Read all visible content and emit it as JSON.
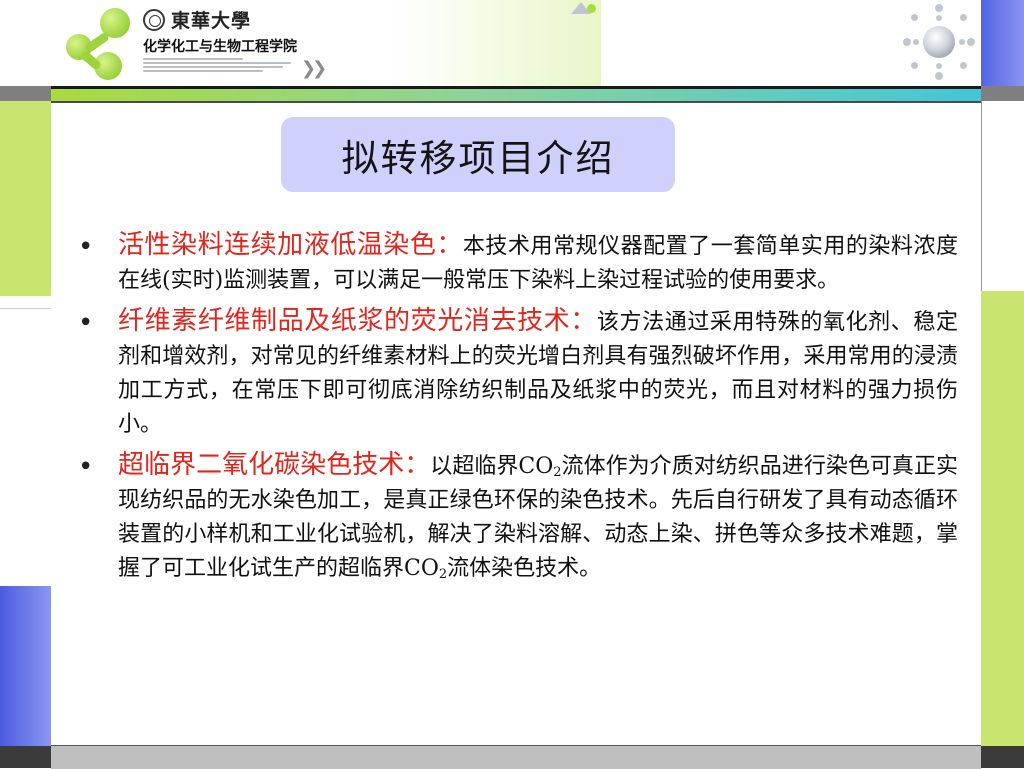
{
  "header": {
    "university_name": "東華大學",
    "school_name": "化学化工与生物工程学院"
  },
  "slide": {
    "title": "拟转移项目介绍",
    "bullets": [
      {
        "mark": "•",
        "lead": "活性染料连续加液低温染色：",
        "body": "本技术用常规仪器配置了一套简单实用的染料浓度在线(实时)监测装置，可以满足一般常压下染料上染过程试验的使用要求。"
      },
      {
        "mark": "•",
        "lead": "纤维素纤维制品及纸浆的荧光消去技术：",
        "body": "该方法通过采用特殊的氧化剂、稳定剂和增效剂，对常见的纤维素材料上的荧光增白剂具有强烈破坏作用，采用常用的浸渍加工方式，在常压下即可彻底消除纺织制品及纸浆中的荧光，而且对材料的强力损伤小。"
      },
      {
        "mark": "•",
        "lead": "超临界二氧化碳染色技术：",
        "body_a": "以超临界CO",
        "sub_a": "2",
        "body_b": "流体作为介质对纺织品进行染色可真正实现纺织品的无水染色加工，是真正绿色环保的染色技术。先后自行研发了具有动态循环装置的小样机和工业化试验机，解决了染料溶解、动态上染、拼色等众多技术难题，掌握了可工业化试生产的超临界CO",
        "sub_b": "2",
        "body_c": "流体染色技术。"
      }
    ]
  },
  "colors": {
    "title_box": "#cfd0fb",
    "lead_text": "#e0261c",
    "accent_green": "#a9db3c",
    "accent_blue": "#5c6ddb"
  }
}
